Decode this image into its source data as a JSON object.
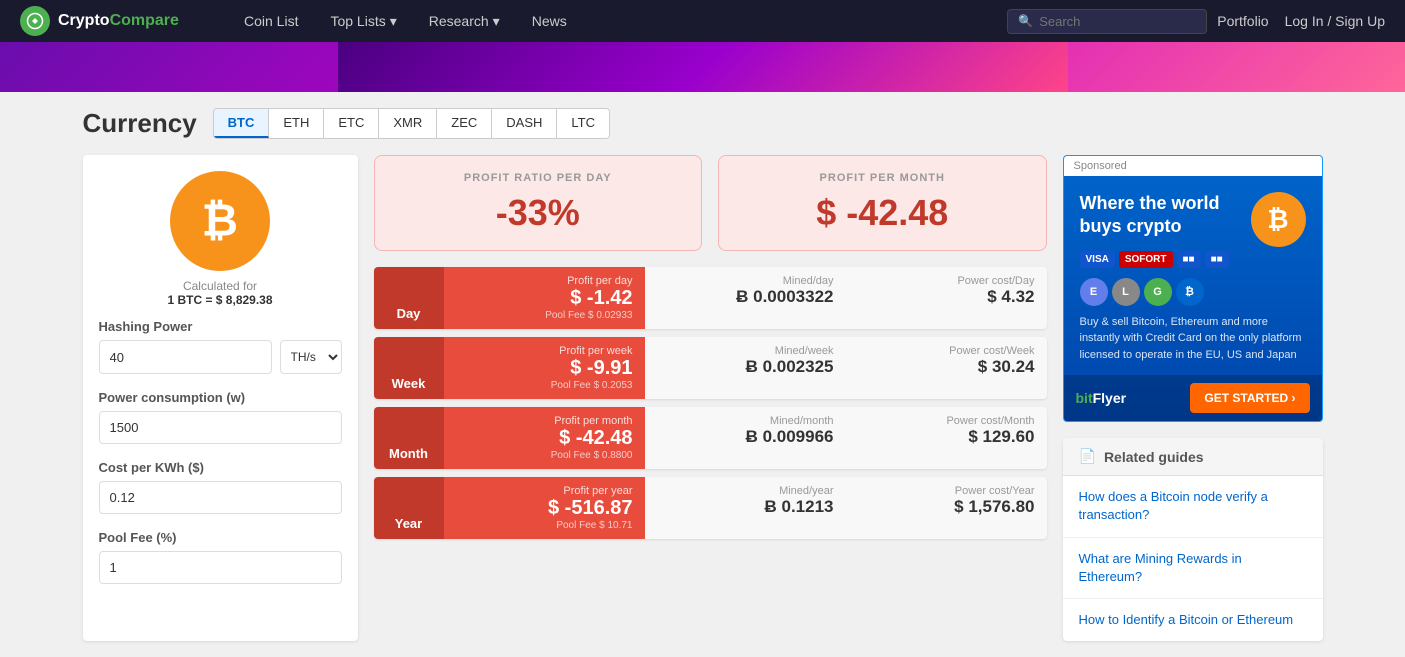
{
  "navbar": {
    "logo_crypto": "Crypto",
    "logo_compare": "Compare",
    "links": [
      {
        "id": "coin-list",
        "label": "Coin List",
        "hasDropdown": false
      },
      {
        "id": "top-lists",
        "label": "Top Lists",
        "hasDropdown": true
      },
      {
        "id": "research",
        "label": "Research",
        "hasDropdown": true
      },
      {
        "id": "news",
        "label": "News",
        "hasDropdown": false
      }
    ],
    "search_placeholder": "Search",
    "portfolio_label": "Portfolio",
    "login_label": "Log In / Sign Up"
  },
  "currency": {
    "title": "Currency",
    "tabs": [
      {
        "id": "btc",
        "label": "BTC",
        "active": true
      },
      {
        "id": "eth",
        "label": "ETH",
        "active": false
      },
      {
        "id": "etc",
        "label": "ETC",
        "active": false
      },
      {
        "id": "xmr",
        "label": "XMR",
        "active": false
      },
      {
        "id": "zec",
        "label": "ZEC",
        "active": false
      },
      {
        "id": "dash",
        "label": "DASH",
        "active": false
      },
      {
        "id": "ltc",
        "label": "LTC",
        "active": false
      }
    ]
  },
  "left_panel": {
    "calc_for_label": "Calculated for",
    "calc_for_value": "1 BTC = $ 8,829.38",
    "hashing_power_label": "Hashing Power",
    "hashing_power_value": "40",
    "hashing_power_unit": "TH/s",
    "power_consumption_label": "Power consumption (w)",
    "power_consumption_value": "1500",
    "cost_per_kwh_label": "Cost per KWh ($)",
    "cost_per_kwh_value": "0.12",
    "pool_fee_label": "Pool Fee (%)",
    "pool_fee_value": "1"
  },
  "profit_summary": {
    "ratio_label": "PROFIT RATIO PER DAY",
    "ratio_value": "-33%",
    "month_label": "PROFIT PER MONTH",
    "month_value": "$ -42.48"
  },
  "stats": [
    {
      "period": "Day",
      "profit_label": "Profit per day",
      "profit_value": "$ -1.42",
      "pool_fee": "Pool Fee $ 0.02933",
      "mined_label": "Mined/day",
      "mined_value": "Ƀ 0.0003322",
      "power_label": "Power cost/Day",
      "power_value": "$ 4.32"
    },
    {
      "period": "Week",
      "profit_label": "Profit per week",
      "profit_value": "$ -9.91",
      "pool_fee": "Pool Fee $ 0.2053",
      "mined_label": "Mined/week",
      "mined_value": "Ƀ 0.002325",
      "power_label": "Power cost/Week",
      "power_value": "$ 30.24"
    },
    {
      "period": "Month",
      "profit_label": "Profit per month",
      "profit_value": "$ -42.48",
      "pool_fee": "Pool Fee $ 0.8800",
      "mined_label": "Mined/month",
      "mined_value": "Ƀ 0.009966",
      "power_label": "Power cost/Month",
      "power_value": "$ 129.60"
    },
    {
      "period": "Year",
      "profit_label": "Profit per year",
      "profit_value": "$ -516.87",
      "pool_fee": "Pool Fee $ 10.71",
      "mined_label": "Mined/year",
      "mined_value": "Ƀ 0.1213",
      "power_label": "Power cost/Year",
      "power_value": "$ 1,576.80"
    }
  ],
  "ad": {
    "sponsored_label": "Sponsored",
    "title": "Where the world buys crypto",
    "payment_methods": [
      "VISA",
      "SOFORT",
      "CC",
      "CC2"
    ],
    "description": "Buy & sell Bitcoin, Ethereum and more instantly with Credit Card on the only platform licensed to operate in the EU, US and Japan",
    "logo": "bitFlyer",
    "cta_label": "GET STARTED ›"
  },
  "related_guides": {
    "header": "Related guides",
    "items": [
      "How does a Bitcoin node verify a transaction?",
      "What are Mining Rewards in Ethereum?",
      "How to Identify a Bitcoin or Ethereum"
    ]
  }
}
